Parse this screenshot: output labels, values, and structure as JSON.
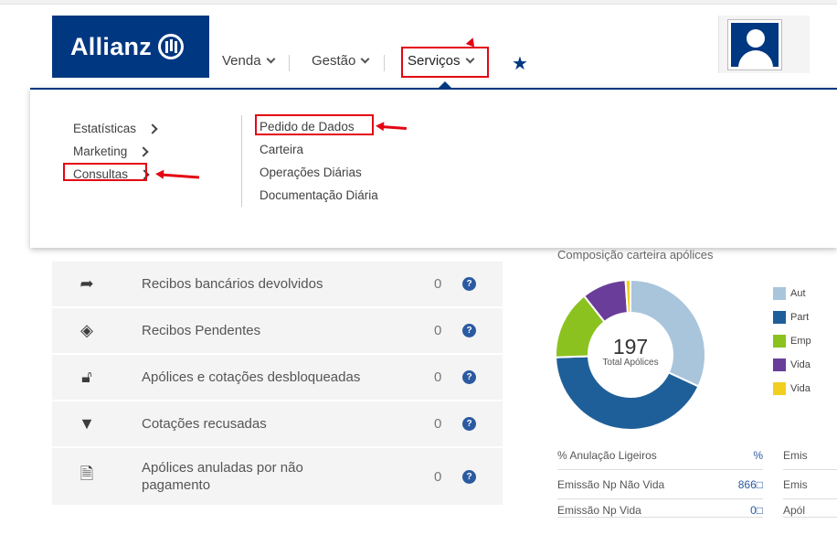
{
  "header": {
    "logo": {
      "text": "Allianz"
    },
    "nav": [
      {
        "label": "Venda"
      },
      {
        "label": "Gestão"
      },
      {
        "label": "Serviços"
      }
    ]
  },
  "dropdown": {
    "left_items": [
      {
        "label": "Estatísticas"
      },
      {
        "label": "Marketing"
      },
      {
        "label": "Consultas"
      }
    ],
    "right_items": [
      {
        "label": "Pedido de Dados"
      },
      {
        "label": "Carteira"
      },
      {
        "label": "Operações Diárias"
      },
      {
        "label": "Documentação Diária"
      }
    ]
  },
  "alerts": {
    "rows": [
      {
        "icon": "reply-arrow-icon",
        "label": "Recibos bancários devolvidos",
        "count": "0"
      },
      {
        "icon": "layers-icon",
        "label": "Recibos Pendentes",
        "count": "0"
      },
      {
        "icon": "unlock-icon",
        "label": "Apólices e cotações desbloqueadas",
        "count": "0"
      },
      {
        "icon": "thumbs-down-icon",
        "label": "Cotações recusadas",
        "count": "0"
      },
      {
        "icon": "document-gear-icon",
        "label": "Apólices anuladas por não pagamento",
        "count": "0"
      }
    ]
  },
  "portfolio": {
    "title": "Composição carteira apólices",
    "total": "197",
    "total_label": "Total Apólices",
    "legend": [
      {
        "label": "Aut",
        "color": "#a9c5dc"
      },
      {
        "label": "Part",
        "color": "#1f5f99"
      },
      {
        "label": "Emp",
        "color": "#8bc21f"
      },
      {
        "label": "Vida",
        "color": "#6a3d9a"
      },
      {
        "label": "Vida",
        "color": "#f2cf1e"
      }
    ],
    "stats": [
      {
        "label": "% Anulação Ligeiros",
        "value": "%"
      },
      {
        "label": "Emissão Np Não Vida",
        "value": "866□"
      },
      {
        "label": "Emissão Np Vida",
        "value": "0□"
      }
    ],
    "stats2": [
      {
        "label": "Emis"
      },
      {
        "label": "Emis"
      },
      {
        "label": "Apól"
      }
    ]
  },
  "chart_data": {
    "type": "pie",
    "title": "Composição carteira apólices",
    "categories": [
      "Aut",
      "Part",
      "Emp",
      "Vida",
      "Vida"
    ],
    "values": [
      30,
      40,
      14,
      9,
      1
    ],
    "colors": [
      "#a9c5dc",
      "#1f5f99",
      "#8bc21f",
      "#6a3d9a",
      "#f2cf1e"
    ]
  }
}
